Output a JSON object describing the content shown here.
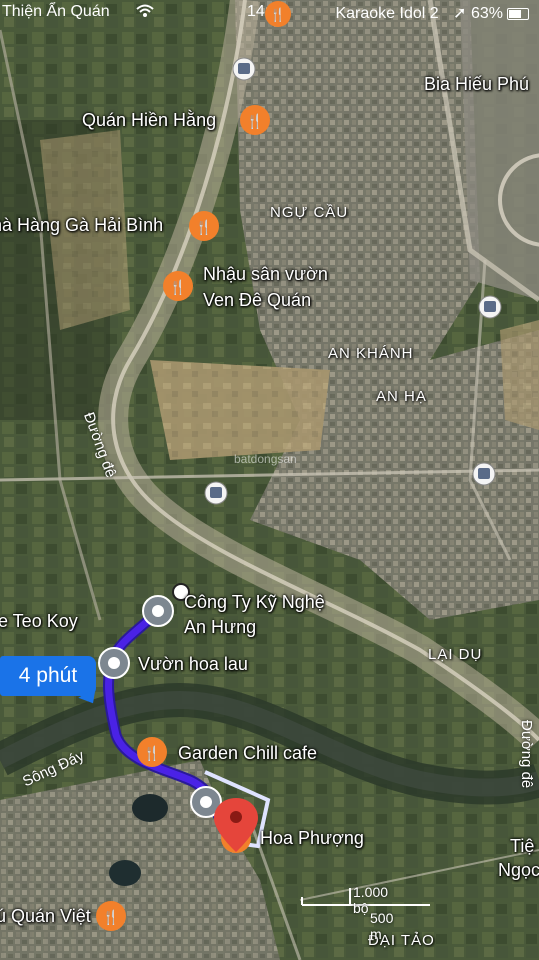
{
  "status_bar": {
    "left_text": "Thiện Ẩn Quán",
    "time": "14:00",
    "right_text": "Karaoke Idol 2",
    "battery": "63%"
  },
  "eta": {
    "label": "4 phút"
  },
  "places": [
    {
      "name": "Quán Hiền Hằng",
      "type": "restaurant"
    },
    {
      "name": "hà Hàng Gà Hải Bình",
      "type": "restaurant"
    },
    {
      "name": "Nhậu sân vườn",
      "type": "restaurant"
    },
    {
      "name": "Ven Đê Quán",
      "type": "restaurant"
    },
    {
      "name": "Bia Hiếu Phú",
      "type": "restaurant"
    },
    {
      "name": "Công Ty Kỹ Nghệ",
      "type": "place"
    },
    {
      "name": "An Hưng",
      "type": "place"
    },
    {
      "name": "e Teo Koy",
      "type": "place"
    },
    {
      "name": "Vườn hoa lau",
      "type": "place"
    },
    {
      "name": "Garden Chill cafe",
      "type": "restaurant"
    },
    {
      "name": "Hoa Phượng",
      "type": "restaurant"
    },
    {
      "name": "Tiệ",
      "type": "place"
    },
    {
      "name": "Ngọc",
      "type": "place"
    },
    {
      "name": "ú Quán Việt",
      "type": "restaurant"
    }
  ],
  "areas": {
    "ngu_cau": "NGỰ CẦU",
    "an_khanh": "AN KHÁNH",
    "an_ha": "AN HẠ",
    "lai_du": "LẠI DỤ",
    "dai_tao": "ĐẠI TẢO"
  },
  "roads": {
    "duong_de_1": "Đường đê",
    "duong_de_2": "Đường đê",
    "song_day": "Sông Đáy"
  },
  "watermark": "batdongsan",
  "scale": {
    "top": "1.000 bộ",
    "bottom": "500 m"
  },
  "colors": {
    "route": "#4a22e6",
    "eta_bg": "#1a73e8",
    "poi": "#f2802b",
    "destination": "#e5453b"
  }
}
